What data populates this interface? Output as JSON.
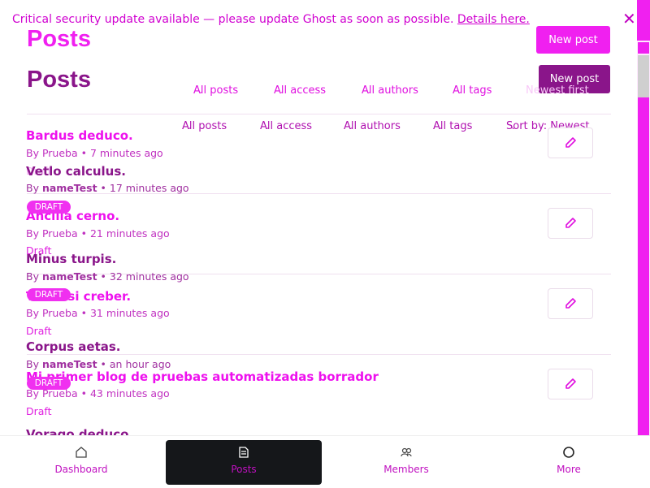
{
  "banner": {
    "text": "Critical security update available — please update Ghost as soon as possible.",
    "link": "Details here."
  },
  "header": {
    "title": "Posts",
    "new_post_label": "New post"
  },
  "filters_a": [
    "All posts",
    "All access",
    "All authors",
    "All tags",
    "Newest first"
  ],
  "filters_b": [
    "All posts",
    "All access",
    "All authors",
    "All tags",
    "Sort by: Newest"
  ],
  "posts_a": [
    {
      "title": "Bardus deduco.",
      "author": "Prueba",
      "time": "7 minutes ago",
      "status": "Draft"
    },
    {
      "title": "Ancilla cerno.",
      "author": "Prueba",
      "time": "21 minutes ago",
      "status": "Draft"
    },
    {
      "title": "Tametsi creber.",
      "author": "Prueba",
      "time": "31 minutes ago",
      "status": "Draft"
    },
    {
      "title": "Mi primer blog de pruebas automatizadas borrador",
      "author": "Prueba",
      "time": "43 minutes ago",
      "status": "Draft"
    },
    {
      "title": "Vorago deduco.",
      "author": "",
      "time": "",
      "status": ""
    }
  ],
  "posts_b": [
    {
      "title": "Vetlo calculus.",
      "author": "nameTest",
      "time": "17 minutes ago",
      "badge": "DRAFT"
    },
    {
      "title": "Minus turpis.",
      "author": "nameTest",
      "time": "32 minutes ago",
      "badge": "DRAFT"
    },
    {
      "title": "Corpus aetas.",
      "author": "nameTest",
      "time": "an hour ago",
      "badge": "DRAFT"
    }
  ],
  "nav": {
    "dashboard": "Dashboard",
    "posts": "Posts",
    "members": "Members",
    "more": "More"
  },
  "colors": {
    "accent": "#f020f0",
    "dark_accent": "#8a158a",
    "nav_active": "#15171a"
  }
}
